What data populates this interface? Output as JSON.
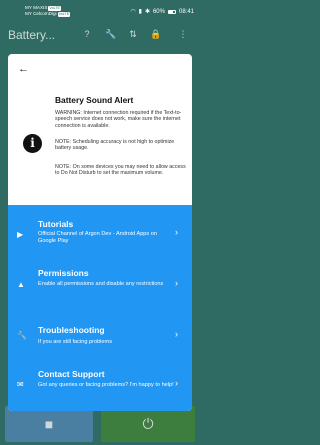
{
  "status_bar": {
    "carrier1": "MY MAXIS",
    "carrier1_tag": "VoLTE",
    "carrier2": "MY CelcomDigi",
    "carrier2_tag": "VoLTE",
    "battery": "60%",
    "time": "08:41"
  },
  "app_bar": {
    "title": "Battery..."
  },
  "dialog": {
    "title": "Battery Sound Alert",
    "paragraph1": "WARNING: Internet connection required if the Text-to-speech service does not work, make sure the internet connection is available.",
    "paragraph2": "NOTE: Scheduling accuracy is not high to optimize battery usage.",
    "paragraph3": "NOTE: On some devices you may need to allow access to Do Not Disturb to set the maximum volume.",
    "menu": [
      {
        "icon": "play-icon",
        "title": "Tutorials",
        "subtitle": "Official Channel of Argon Dev - Android Apps on Google Play"
      },
      {
        "icon": "warning-icon",
        "title": "Permissions",
        "subtitle": "Enable all permissions and disable any restrictions"
      },
      {
        "icon": "wrench-icon",
        "title": "Troubleshooting",
        "subtitle": "If you are still facing problems"
      },
      {
        "icon": "mail-icon",
        "title": "Contact Support",
        "subtitle": "Got any queries or facing problems? I'm happy to help!"
      }
    ]
  },
  "colors": {
    "accent": "#2196f3",
    "appbar": "#2f6b62"
  }
}
